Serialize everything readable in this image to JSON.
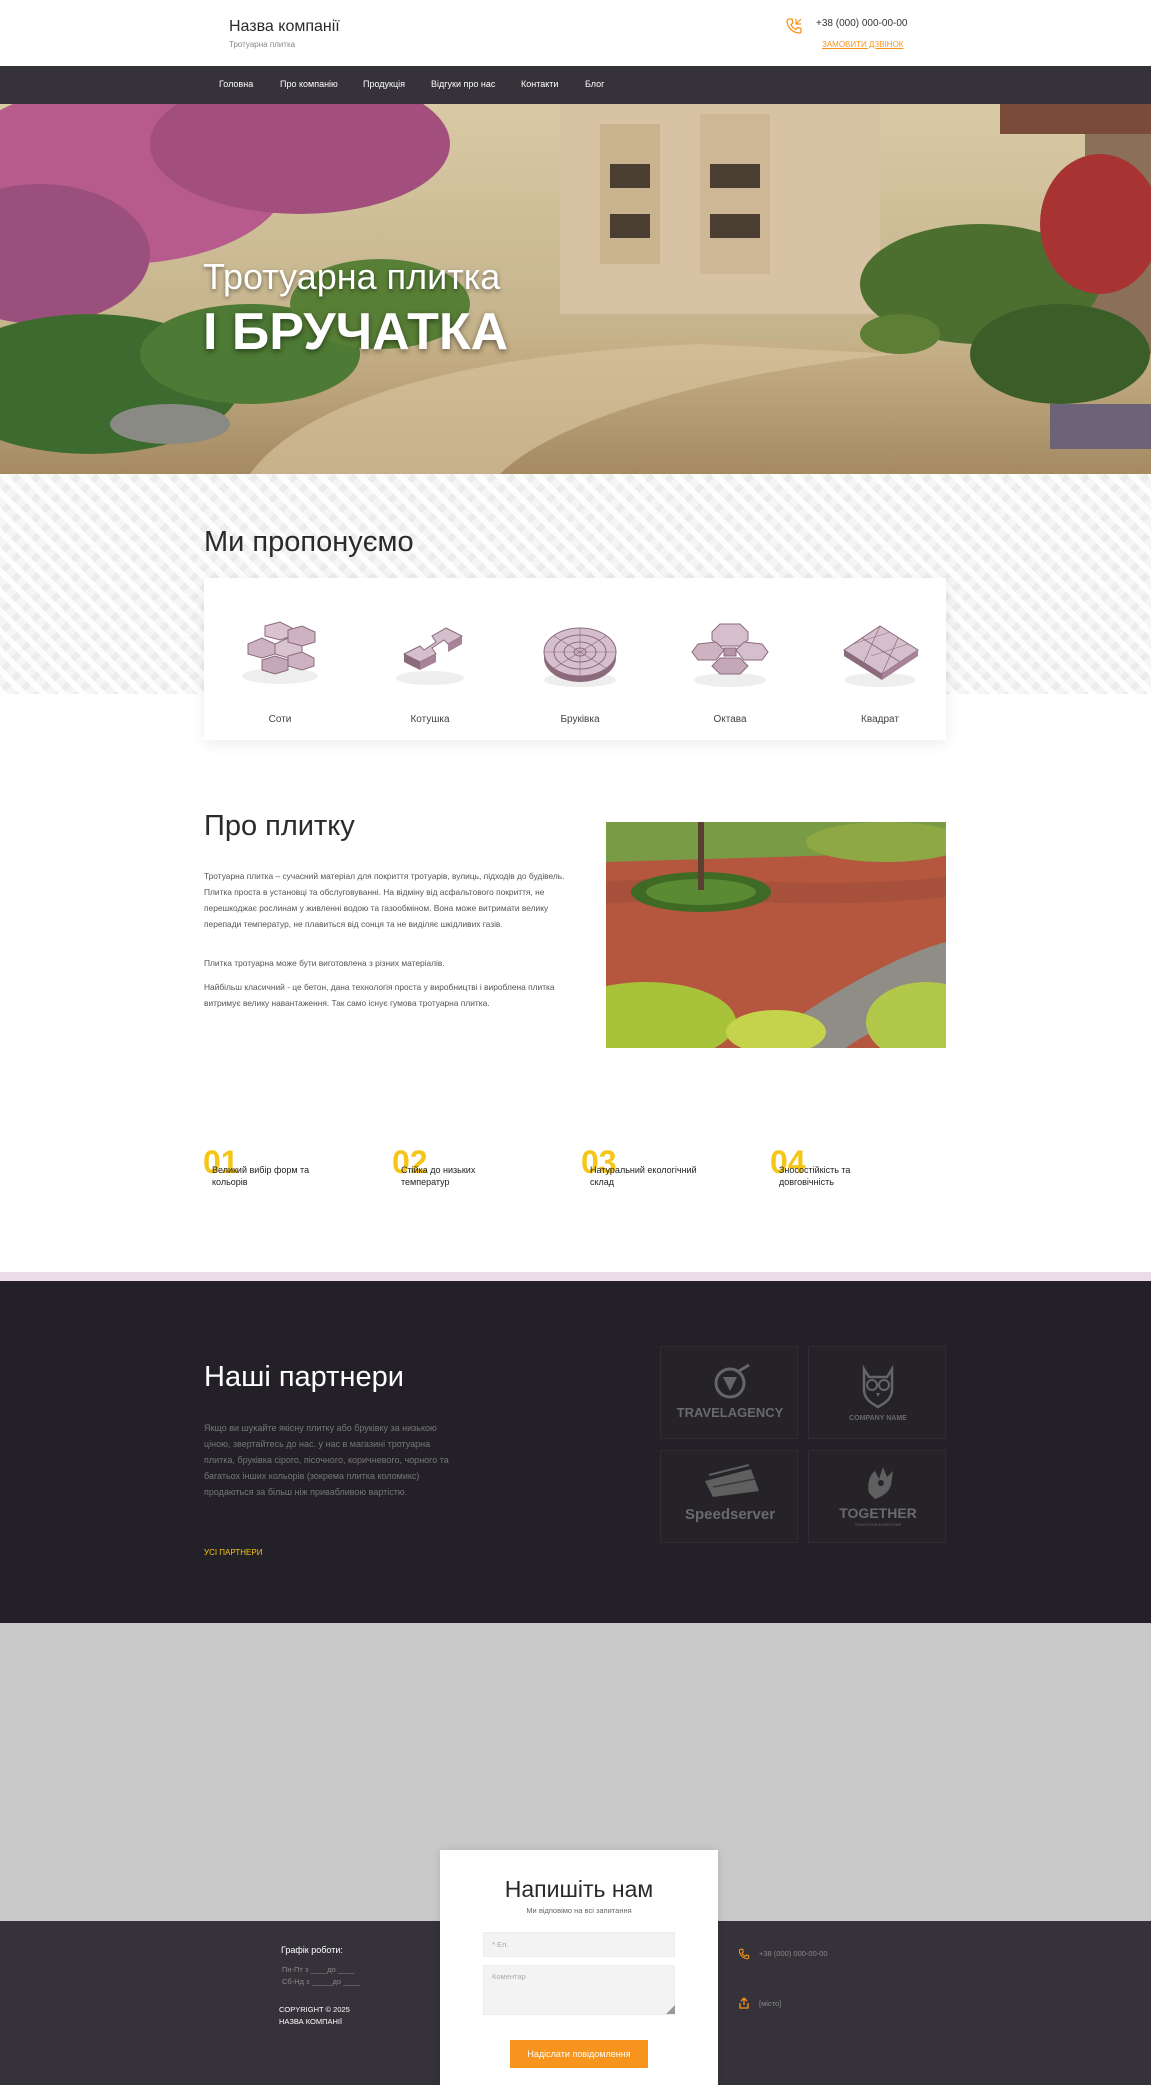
{
  "header": {
    "company_name": "Назва компанії",
    "tagline": "Тротуарна плитка",
    "phone": "+38 (000) 000-00-00",
    "callback_label": "ЗАМОВИТИ ДЗВІНОК",
    "phone_icon": "phone-icon"
  },
  "nav": {
    "items": [
      {
        "label": "Головна"
      },
      {
        "label": "Про компанію"
      },
      {
        "label": "Продукція"
      },
      {
        "label": "Відгуки про нас"
      },
      {
        "label": "Контакти"
      },
      {
        "label": "Блог"
      }
    ]
  },
  "hero": {
    "line1": "Тротуарна плитка",
    "line2": "І БРУЧАТКА"
  },
  "offer": {
    "title": "Ми пропонуємо",
    "tiles": [
      {
        "label": "Соти",
        "icon": "honeycomb-tile-icon"
      },
      {
        "label": "Котушка",
        "icon": "spool-tile-icon"
      },
      {
        "label": "Бруківка",
        "icon": "round-paver-icon"
      },
      {
        "label": "Октава",
        "icon": "octave-tile-icon"
      },
      {
        "label": "Квадрат",
        "icon": "square-tile-icon"
      }
    ]
  },
  "about": {
    "title": "Про плитку",
    "paragraphs": [
      "Тротуарна плитка – сучасний матеріал для покриття тротуарів, вулиць, підходів до будівель. Плитка проста в установці та обслуговуванні. На відміну від асфальтового покриття, не перешкоджає рослинам у живленні водою та газообміном. Вона може витримати велику перепади температур, не плавиться від сонця та не виділяє шкідливих газів.",
      "Плитка тротуарна може бути виготовлена з різних матеріалів.",
      "Найбільш класичний - це бетон, дана технологія проста у виробництві і вироблена плитка витримує велику навантаження. Так само існує гумова тротуарна плитка."
    ]
  },
  "features": [
    {
      "num": "01",
      "text": "Великий вибір форм та кольорів"
    },
    {
      "num": "02",
      "text": "Стійка до низьких температур"
    },
    {
      "num": "03",
      "text": "Натуральний екологічний склад"
    },
    {
      "num": "04",
      "text": "Зносостійкість та довговічність"
    }
  ],
  "partners": {
    "title": "Наші партнери",
    "description": "Якщо ви шукайте якісну плитку або бруківку за низькою ціною, звертайтесь до нас. у нас в магазині тротуарна плитка, бруківка сірого, пісочного, коричневого, чорного та багатьох інших кольорів (зокрема плитка коломикс) продаються за більш ніж привабливою вартістю.",
    "all_label": "УСІ ПАРТНЕРИ",
    "logos": [
      {
        "name": "TRAVELAGENCY",
        "icon": "travel-agency-logo-icon"
      },
      {
        "name": "COMPANY NAME",
        "icon": "owl-logo-icon"
      },
      {
        "name": "Speedserver",
        "icon": "speedserver-logo-icon"
      },
      {
        "name": "TOGETHER",
        "tagline": "TEACH FOR EVERYONE",
        "icon": "hand-logo-icon"
      }
    ]
  },
  "contact": {
    "title": "Напишіть нам",
    "subtitle": "Ми відповімо на всі запитання",
    "email_placeholder": "* Ел.",
    "comment_placeholder": "Коментар",
    "send_label": "Надіслати повідомлення"
  },
  "footer": {
    "schedule_title": "Графік роботи:",
    "schedule_weekdays": "Пн-Пт з ____до ____",
    "schedule_weekend": "Сб-Нд з _____до ____",
    "copyright_line1": "COPYRIGHT © 2025",
    "copyright_line2": "НАЗВА КОМПАНІЇ",
    "phone": "+38 (000) 000-00-00",
    "city": "[місто]"
  },
  "colors": {
    "accent_orange": "#f7941d",
    "accent_yellow": "#f5c518",
    "nav_bg": "#36323a",
    "partners_bg": "#232027"
  }
}
